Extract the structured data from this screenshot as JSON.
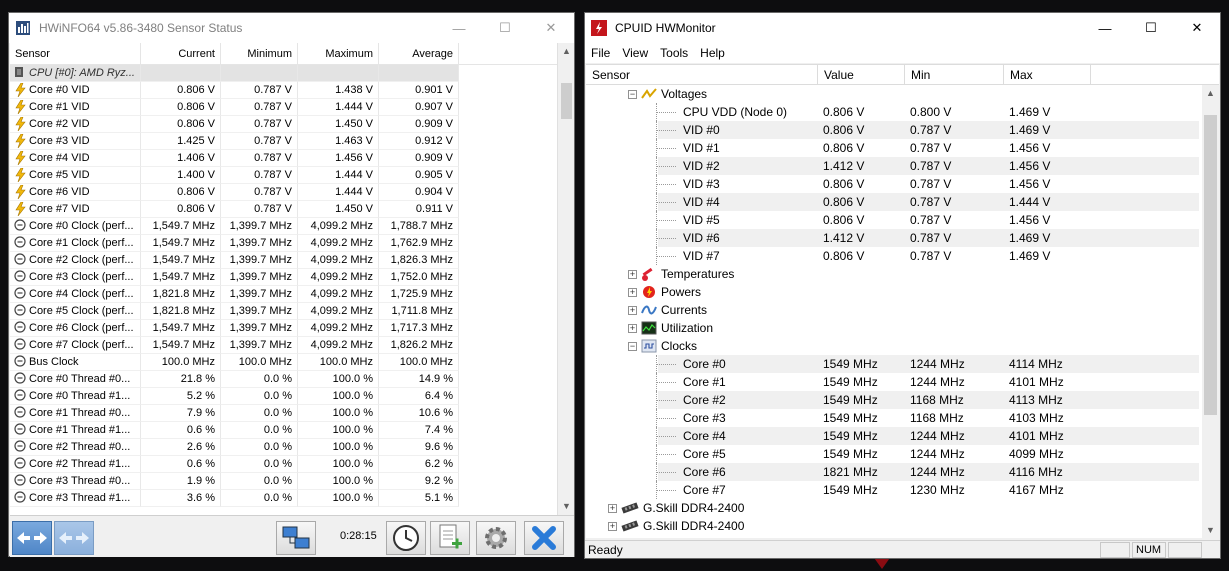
{
  "hwinfo": {
    "title": "HWiNFO64 v5.86-3480 Sensor Status",
    "columns": [
      "Sensor",
      "Current",
      "Minimum",
      "Maximum",
      "Average"
    ],
    "rows": [
      {
        "type": "group",
        "name": "CPU [#0]: AMD Ryz...",
        "cur": "",
        "min": "",
        "max": "",
        "avg": ""
      },
      {
        "type": "vid",
        "name": "Core #0 VID",
        "cur": "0.806 V",
        "min": "0.787 V",
        "max": "1.438 V",
        "avg": "0.901 V"
      },
      {
        "type": "vid",
        "name": "Core #1 VID",
        "cur": "0.806 V",
        "min": "0.787 V",
        "max": "1.444 V",
        "avg": "0.907 V"
      },
      {
        "type": "vid",
        "name": "Core #2 VID",
        "cur": "0.806 V",
        "min": "0.787 V",
        "max": "1.450 V",
        "avg": "0.909 V"
      },
      {
        "type": "vid",
        "name": "Core #3 VID",
        "cur": "1.425 V",
        "min": "0.787 V",
        "max": "1.463 V",
        "avg": "0.912 V"
      },
      {
        "type": "vid",
        "name": "Core #4 VID",
        "cur": "1.406 V",
        "min": "0.787 V",
        "max": "1.456 V",
        "avg": "0.909 V"
      },
      {
        "type": "vid",
        "name": "Core #5 VID",
        "cur": "1.400 V",
        "min": "0.787 V",
        "max": "1.444 V",
        "avg": "0.905 V"
      },
      {
        "type": "vid",
        "name": "Core #6 VID",
        "cur": "0.806 V",
        "min": "0.787 V",
        "max": "1.444 V",
        "avg": "0.904 V"
      },
      {
        "type": "vid",
        "name": "Core #7 VID",
        "cur": "0.806 V",
        "min": "0.787 V",
        "max": "1.450 V",
        "avg": "0.911 V"
      },
      {
        "type": "clock",
        "name": "Core #0 Clock (perf...",
        "cur": "1,549.7 MHz",
        "min": "1,399.7 MHz",
        "max": "4,099.2 MHz",
        "avg": "1,788.7 MHz"
      },
      {
        "type": "clock",
        "name": "Core #1 Clock (perf...",
        "cur": "1,549.7 MHz",
        "min": "1,399.7 MHz",
        "max": "4,099.2 MHz",
        "avg": "1,762.9 MHz"
      },
      {
        "type": "clock",
        "name": "Core #2 Clock (perf...",
        "cur": "1,549.7 MHz",
        "min": "1,399.7 MHz",
        "max": "4,099.2 MHz",
        "avg": "1,826.3 MHz"
      },
      {
        "type": "clock",
        "name": "Core #3 Clock (perf...",
        "cur": "1,549.7 MHz",
        "min": "1,399.7 MHz",
        "max": "4,099.2 MHz",
        "avg": "1,752.0 MHz"
      },
      {
        "type": "clock",
        "name": "Core #4 Clock (perf...",
        "cur": "1,821.8 MHz",
        "min": "1,399.7 MHz",
        "max": "4,099.2 MHz",
        "avg": "1,725.9 MHz"
      },
      {
        "type": "clock",
        "name": "Core #5 Clock (perf...",
        "cur": "1,821.8 MHz",
        "min": "1,399.7 MHz",
        "max": "4,099.2 MHz",
        "avg": "1,711.8 MHz"
      },
      {
        "type": "clock",
        "name": "Core #6 Clock (perf...",
        "cur": "1,549.7 MHz",
        "min": "1,399.7 MHz",
        "max": "4,099.2 MHz",
        "avg": "1,717.3 MHz"
      },
      {
        "type": "clock",
        "name": "Core #7 Clock (perf...",
        "cur": "1,549.7 MHz",
        "min": "1,399.7 MHz",
        "max": "4,099.2 MHz",
        "avg": "1,826.2 MHz"
      },
      {
        "type": "clock",
        "name": "Bus Clock",
        "cur": "100.0 MHz",
        "min": "100.0 MHz",
        "max": "100.0 MHz",
        "avg": "100.0 MHz"
      },
      {
        "type": "clock",
        "name": "Core #0 Thread #0...",
        "cur": "21.8 %",
        "min": "0.0 %",
        "max": "100.0 %",
        "avg": "14.9 %"
      },
      {
        "type": "clock",
        "name": "Core #0 Thread #1...",
        "cur": "5.2 %",
        "min": "0.0 %",
        "max": "100.0 %",
        "avg": "6.4 %"
      },
      {
        "type": "clock",
        "name": "Core #1 Thread #0...",
        "cur": "7.9 %",
        "min": "0.0 %",
        "max": "100.0 %",
        "avg": "10.6 %"
      },
      {
        "type": "clock",
        "name": "Core #1 Thread #1...",
        "cur": "0.6 %",
        "min": "0.0 %",
        "max": "100.0 %",
        "avg": "7.4 %"
      },
      {
        "type": "clock",
        "name": "Core #2 Thread #0...",
        "cur": "2.6 %",
        "min": "0.0 %",
        "max": "100.0 %",
        "avg": "9.6 %"
      },
      {
        "type": "clock",
        "name": "Core #2 Thread #1...",
        "cur": "0.6 %",
        "min": "0.0 %",
        "max": "100.0 %",
        "avg": "6.2 %"
      },
      {
        "type": "clock",
        "name": "Core #3 Thread #0...",
        "cur": "1.9 %",
        "min": "0.0 %",
        "max": "100.0 %",
        "avg": "9.2 %"
      },
      {
        "type": "clock",
        "name": "Core #3 Thread #1...",
        "cur": "3.6 %",
        "min": "0.0 %",
        "max": "100.0 %",
        "avg": "5.1 %"
      }
    ],
    "timer": "0:28:15"
  },
  "hwmon": {
    "title": "CPUID HWMonitor",
    "menu": [
      "File",
      "View",
      "Tools",
      "Help"
    ],
    "columns": [
      "Sensor",
      "Value",
      "Min",
      "Max"
    ],
    "rows": [
      {
        "kind": "node",
        "indent": 1,
        "expander": "−",
        "icon": "voltage-icon",
        "label": "Voltages",
        "value": "",
        "min": "",
        "max": ""
      },
      {
        "kind": "leaf",
        "indent": 3,
        "label": "CPU VDD (Node 0)",
        "value": "0.806 V",
        "min": "0.800 V",
        "max": "1.469 V"
      },
      {
        "kind": "leaf",
        "indent": 3,
        "label": "VID #0",
        "value": "0.806 V",
        "min": "0.787 V",
        "max": "1.469 V"
      },
      {
        "kind": "leaf",
        "indent": 3,
        "label": "VID #1",
        "value": "0.806 V",
        "min": "0.787 V",
        "max": "1.456 V"
      },
      {
        "kind": "leaf",
        "indent": 3,
        "label": "VID #2",
        "value": "1.412 V",
        "min": "0.787 V",
        "max": "1.456 V"
      },
      {
        "kind": "leaf",
        "indent": 3,
        "label": "VID #3",
        "value": "0.806 V",
        "min": "0.787 V",
        "max": "1.456 V"
      },
      {
        "kind": "leaf",
        "indent": 3,
        "label": "VID #4",
        "value": "0.806 V",
        "min": "0.787 V",
        "max": "1.444 V"
      },
      {
        "kind": "leaf",
        "indent": 3,
        "label": "VID #5",
        "value": "0.806 V",
        "min": "0.787 V",
        "max": "1.456 V"
      },
      {
        "kind": "leaf",
        "indent": 3,
        "label": "VID #6",
        "value": "1.412 V",
        "min": "0.787 V",
        "max": "1.469 V"
      },
      {
        "kind": "leaf",
        "indent": 3,
        "label": "VID #7",
        "value": "0.806 V",
        "min": "0.787 V",
        "max": "1.469 V"
      },
      {
        "kind": "node",
        "indent": 1,
        "expander": "+",
        "icon": "temperature-icon",
        "label": "Temperatures",
        "value": "",
        "min": "",
        "max": ""
      },
      {
        "kind": "node",
        "indent": 1,
        "expander": "+",
        "icon": "power-icon",
        "label": "Powers",
        "value": "",
        "min": "",
        "max": ""
      },
      {
        "kind": "node",
        "indent": 1,
        "expander": "+",
        "icon": "current-icon",
        "label": "Currents",
        "value": "",
        "min": "",
        "max": ""
      },
      {
        "kind": "node",
        "indent": 1,
        "expander": "+",
        "icon": "utilization-icon",
        "label": "Utilization",
        "value": "",
        "min": "",
        "max": ""
      },
      {
        "kind": "node",
        "indent": 1,
        "expander": "−",
        "icon": "clock-icon",
        "label": "Clocks",
        "value": "",
        "min": "",
        "max": ""
      },
      {
        "kind": "leaf",
        "indent": 3,
        "label": "Core #0",
        "value": "1549 MHz",
        "min": "1244 MHz",
        "max": "4114 MHz"
      },
      {
        "kind": "leaf",
        "indent": 3,
        "label": "Core #1",
        "value": "1549 MHz",
        "min": "1244 MHz",
        "max": "4101 MHz"
      },
      {
        "kind": "leaf",
        "indent": 3,
        "label": "Core #2",
        "value": "1549 MHz",
        "min": "1168 MHz",
        "max": "4113 MHz"
      },
      {
        "kind": "leaf",
        "indent": 3,
        "label": "Core #3",
        "value": "1549 MHz",
        "min": "1168 MHz",
        "max": "4103 MHz"
      },
      {
        "kind": "leaf",
        "indent": 3,
        "label": "Core #4",
        "value": "1549 MHz",
        "min": "1244 MHz",
        "max": "4101 MHz"
      },
      {
        "kind": "leaf",
        "indent": 3,
        "label": "Core #5",
        "value": "1549 MHz",
        "min": "1244 MHz",
        "max": "4099 MHz"
      },
      {
        "kind": "leaf",
        "indent": 3,
        "label": "Core #6",
        "value": "1821 MHz",
        "min": "1244 MHz",
        "max": "4116 MHz"
      },
      {
        "kind": "leaf",
        "indent": 3,
        "label": "Core #7",
        "value": "1549 MHz",
        "min": "1230 MHz",
        "max": "4167 MHz"
      },
      {
        "kind": "node",
        "indent": 0,
        "expander": "+",
        "icon": "memory-icon",
        "label": "G.Skill DDR4-2400",
        "value": "",
        "min": "",
        "max": ""
      },
      {
        "kind": "node",
        "indent": 0,
        "expander": "+",
        "icon": "memory-icon",
        "label": "G.Skill DDR4-2400",
        "value": "",
        "min": "",
        "max": ""
      }
    ],
    "status": {
      "ready": "Ready",
      "num": "NUM"
    }
  },
  "colors": {
    "hwmon_brand": "#c4161c",
    "hwinfo_toolbar_blue": "#2a7bd8",
    "bolt": "#f2b90c"
  }
}
